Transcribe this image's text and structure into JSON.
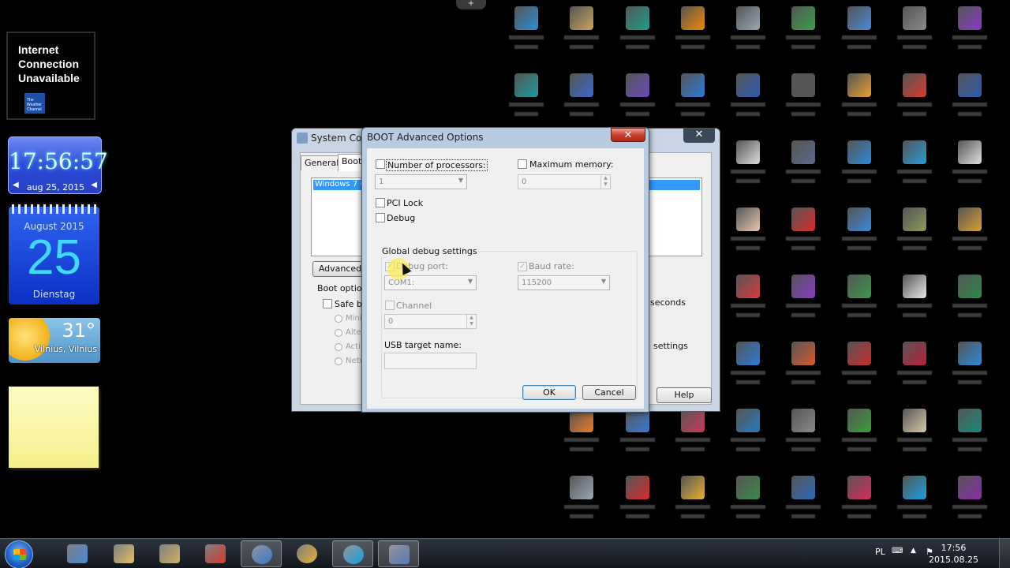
{
  "gadgets": {
    "weather_error": {
      "message_line1": "Internet",
      "message_line2": "Connection",
      "message_line3": "Unavailable",
      "logo_line1": "The",
      "logo_line2": "Weather",
      "logo_line3": "Channel"
    },
    "clock": {
      "time": "17:56:57",
      "date": "aug 25, 2015"
    },
    "calendar": {
      "month": "August 2015",
      "day": "25",
      "weekday": "Dienstag"
    },
    "weather": {
      "temperature": "31°",
      "location": "Vilnius, Vilnius"
    }
  },
  "system_config": {
    "title": "System Conf",
    "tabs": [
      "General",
      "Boot"
    ],
    "selected_os": "Windows 7 (C",
    "advanced_button": "Advanced",
    "boot_options_label": "Boot options",
    "safe_boot_label": "Safe bo",
    "radio_labels": [
      "Mini",
      "Alte",
      "Acti",
      "Netw"
    ],
    "seconds_label": "seconds",
    "settings_label": "settings",
    "help_button": "Help",
    "close_glyph": "✕"
  },
  "boot_dialog": {
    "title": "BOOT Advanced Options",
    "close_glyph": "✕",
    "number_of_processors_label": "Number of processors:",
    "processors_value": "1",
    "maximum_memory_label": "Maximum memory:",
    "maximum_memory_value": "0",
    "pci_lock_label": "PCI Lock",
    "debug_label": "Debug",
    "global_debug_title": "Global debug settings",
    "debug_port_label": "Debug port:",
    "debug_port_value": "COM1:",
    "baud_rate_label": "Baud rate:",
    "baud_rate_value": "115200",
    "channel_label": "Channel",
    "channel_value": "0",
    "usb_target_label": "USB target name:",
    "usb_target_value": "",
    "ok_button": "OK",
    "cancel_button": "Cancel"
  },
  "desktop_icons": [
    {
      "icon": "app-icon",
      "color": "#2a8fd8"
    },
    {
      "icon": "app-icon",
      "color": "#c9a35a"
    },
    {
      "icon": "app-icon",
      "color": "#1aa08a"
    },
    {
      "icon": "vlc-icon",
      "color": "#f08a00"
    },
    {
      "icon": "recycle-bin-icon",
      "color": "#9aa8b8"
    },
    {
      "icon": "app-icon",
      "color": "#3aa04a"
    },
    {
      "icon": "control-panel-icon",
      "color": "#4a8ad8"
    },
    {
      "icon": "app-icon",
      "color": "#8a8a8a"
    },
    {
      "icon": "onenote-icon",
      "color": "#8a3ac8"
    },
    {
      "icon": "app-icon",
      "color": "#1a9aa0"
    },
    {
      "icon": "app-icon",
      "color": "#3a6ac8"
    },
    {
      "icon": "app-icon",
      "color": "#6a4ab8"
    },
    {
      "icon": "ie-icon",
      "color": "#2a7ad8"
    },
    {
      "icon": "app-icon",
      "color": "#2a5ab0"
    },
    {
      "icon": "app-icon",
      "color": "#555555"
    },
    {
      "icon": "app-icon",
      "color": "#e8a030"
    },
    {
      "icon": "ccleaner-icon",
      "color": "#d83a2a"
    },
    {
      "icon": "word-icon",
      "color": "#2a5ab0"
    },
    {
      "icon": "app-icon",
      "color": "#dddddd"
    },
    {
      "icon": "app-icon",
      "color": "#5a6a8a"
    },
    {
      "icon": "app-icon",
      "color": "#2a8ad8"
    },
    {
      "icon": "app-icon",
      "color": "#2a9ad8"
    },
    {
      "icon": "app-icon",
      "color": "#e0e0e0"
    },
    {
      "icon": "app-icon",
      "color": "#e8c8b0"
    },
    {
      "icon": "app-icon",
      "color": "#d82a2a"
    },
    {
      "icon": "app-icon",
      "color": "#3a8ad8"
    },
    {
      "icon": "app-icon",
      "color": "#8a9a5a"
    },
    {
      "icon": "app-icon",
      "color": "#d8a030"
    },
    {
      "icon": "app-icon",
      "color": "#d83a3a"
    },
    {
      "icon": "onenote-icon",
      "color": "#8a3ac8"
    },
    {
      "icon": "app-icon",
      "color": "#3a9a4a"
    },
    {
      "icon": "app-icon",
      "color": "#e8e8e8"
    },
    {
      "icon": "excel-icon",
      "color": "#2a8a4a"
    },
    {
      "icon": "app-icon",
      "color": "#2a7ad8"
    },
    {
      "icon": "powerpoint-icon",
      "color": "#d85a2a"
    },
    {
      "icon": "app-icon",
      "color": "#c82a2a"
    },
    {
      "icon": "access-icon",
      "color": "#b8203a"
    },
    {
      "icon": "app-icon",
      "color": "#2a8ad8"
    },
    {
      "icon": "app-icon",
      "color": "#e87a2a"
    },
    {
      "icon": "app-icon",
      "color": "#3a7ad8"
    },
    {
      "icon": "app-icon",
      "color": "#c83a5a"
    },
    {
      "icon": "app-icon",
      "color": "#2a7ab8"
    },
    {
      "icon": "app-icon",
      "color": "#8a8a8a"
    },
    {
      "icon": "media-center-icon",
      "color": "#3aa03a"
    },
    {
      "icon": "app-icon",
      "color": "#d8c8a8"
    },
    {
      "icon": "publisher-icon",
      "color": "#1a8a7a"
    },
    {
      "icon": "app-icon",
      "color": "#9aa8b8"
    },
    {
      "icon": "app-icon",
      "color": "#d82a2a"
    },
    {
      "icon": "chrome-icon",
      "color": "#e8b030"
    },
    {
      "icon": "app-icon",
      "color": "#3a8a4a"
    },
    {
      "icon": "google-earth-icon",
      "color": "#2a6ab8"
    },
    {
      "icon": "app-icon",
      "color": "#d82a5a"
    },
    {
      "icon": "skype-icon",
      "color": "#1aa0e0"
    },
    {
      "icon": "onenote-icon",
      "color": "#8a2aa8"
    }
  ],
  "taskbar": {
    "items": [
      {
        "icon": "control-panel-icon",
        "color": "#4a8ad8"
      },
      {
        "icon": "folder-icon",
        "color": "#e8c060"
      },
      {
        "icon": "folder-icon",
        "color": "#d8b060"
      },
      {
        "icon": "ccleaner-icon",
        "color": "#d83a2a"
      },
      {
        "icon": "globe-icon",
        "color": "#3a7ac8"
      },
      {
        "icon": "chrome-icon",
        "color": "#e8b030"
      },
      {
        "icon": "skype-icon",
        "color": "#1aa0e0"
      },
      {
        "icon": "msconfig-icon",
        "color": "#5a7ab8"
      }
    ],
    "language": "PL",
    "time": "17:56",
    "date": "2015.08.25"
  }
}
